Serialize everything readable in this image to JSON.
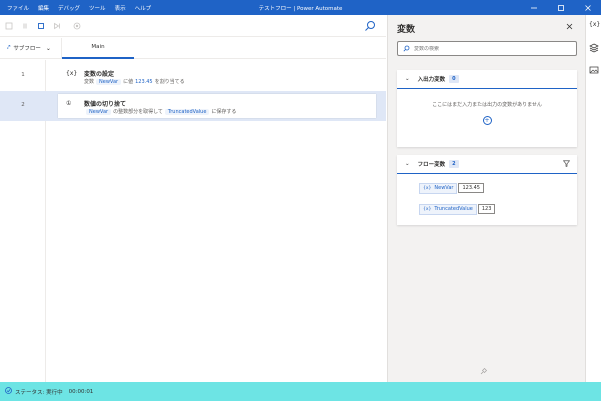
{
  "window": {
    "title": "テストフロー | Power Automate"
  },
  "menu": [
    "ファイル",
    "編集",
    "デバッグ",
    "ツール",
    "表示",
    "ヘルプ"
  ],
  "tabs": {
    "subflow_label": "サブフロー",
    "main_label": "Main"
  },
  "flow": {
    "rows": [
      {
        "num": "1",
        "icon": "{x}",
        "title": "変数の設定",
        "desc_prefix": "変数",
        "var": "NewVar",
        "desc_mid": "に値",
        "value": "123.45",
        "desc_suffix": "を割り当てる"
      },
      {
        "num": "2",
        "icon": "①",
        "title": "数値の切り捨て",
        "var": "NewVar",
        "desc_mid": "の整数部分を取得して",
        "var2": "TruncatedValue",
        "desc_suffix": "に保存する"
      }
    ]
  },
  "variables_panel": {
    "title": "変数",
    "search_placeholder": "変数の検索",
    "io_section": {
      "label": "入出力変数",
      "count": "0",
      "empty_text": "ここにはまだ入力または出力の変数がありません"
    },
    "flow_section": {
      "label": "フロー変数",
      "count": "2",
      "items": [
        {
          "name": "NewVar",
          "value": "123.45"
        },
        {
          "name": "TruncatedValue",
          "value": "123"
        }
      ]
    }
  },
  "status": {
    "label": "ステータス: 実行中",
    "time": "00:00:01"
  },
  "colors": {
    "accent": "#1f63c6",
    "status_bar": "#6de4e4",
    "selected_row": "#dfe7f6"
  }
}
